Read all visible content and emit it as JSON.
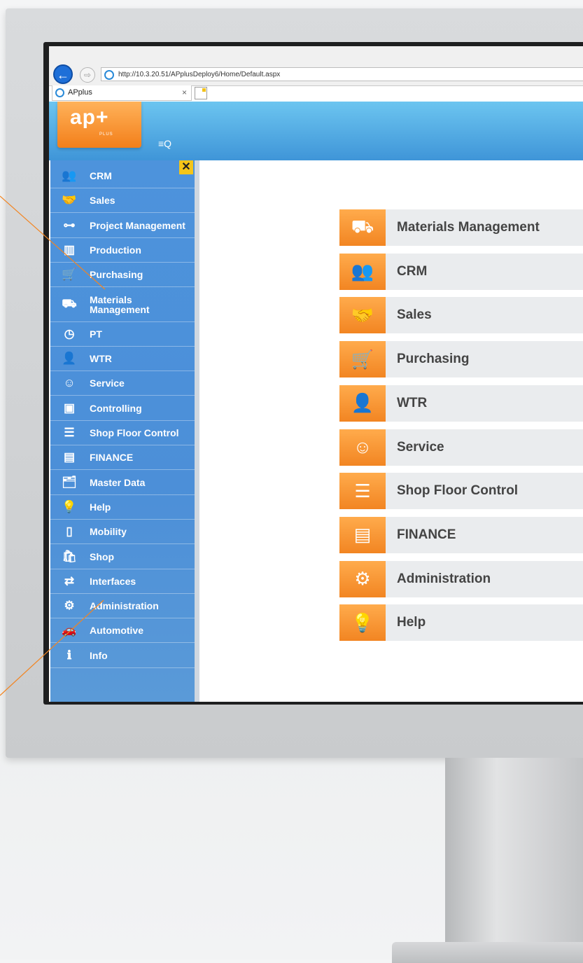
{
  "browser": {
    "url": "http://10.3.20.51/APplusDeploy6/Home/Default.aspx",
    "tab_title": "APplus",
    "tab_close": "×",
    "back_glyph": "←",
    "forward_glyph": "⇨"
  },
  "app": {
    "logo_text": "ap+",
    "logo_subtext": "PLUS",
    "search_toggle_glyph": "≡Q",
    "close_glyph": "✕"
  },
  "sidebar": {
    "items": [
      {
        "label": "CRM",
        "icon": "people-icon",
        "glyph": "👥"
      },
      {
        "label": "Sales",
        "icon": "handshake-icon",
        "glyph": "🤝"
      },
      {
        "label": "Project Management",
        "icon": "org-chart-icon",
        "glyph": "⊶"
      },
      {
        "label": "Production",
        "icon": "factory-icon",
        "glyph": "▥"
      },
      {
        "label": "Purchasing",
        "icon": "cart-icon",
        "glyph": "🛒"
      },
      {
        "label": "Materials Management",
        "icon": "forklift-icon",
        "glyph": "⛟"
      },
      {
        "label": "PT",
        "icon": "time-tracking-icon",
        "glyph": "◷"
      },
      {
        "label": "WTR",
        "icon": "person-clock-icon",
        "glyph": "👤"
      },
      {
        "label": "Service",
        "icon": "service-agent-icon",
        "glyph": "☺"
      },
      {
        "label": "Controlling",
        "icon": "presentation-icon",
        "glyph": "▣"
      },
      {
        "label": "Shop Floor Control",
        "icon": "list-panel-icon",
        "glyph": "☰"
      },
      {
        "label": "FINANCE",
        "icon": "wallet-icon",
        "glyph": "▤"
      },
      {
        "label": "Master Data",
        "icon": "folder-info-icon",
        "glyph": "🗂"
      },
      {
        "label": "Help",
        "icon": "lightbulb-icon",
        "glyph": "💡"
      },
      {
        "label": "Mobility",
        "icon": "phone-icon",
        "glyph": "▯"
      },
      {
        "label": "Shop",
        "icon": "shop-cart-icon",
        "glyph": "🛍"
      },
      {
        "label": "Interfaces",
        "icon": "interfaces-icon",
        "glyph": "⇄"
      },
      {
        "label": "Administration",
        "icon": "sliders-icon",
        "glyph": "⚙"
      },
      {
        "label": "Automotive",
        "icon": "car-icon",
        "glyph": "🚗"
      },
      {
        "label": "Info",
        "icon": "info-icon",
        "glyph": "ℹ"
      }
    ]
  },
  "tiles": [
    {
      "label": "Materials Management",
      "icon": "forklift-icon",
      "glyph": "⛟"
    },
    {
      "label": "CRM",
      "icon": "people-icon",
      "glyph": "👥"
    },
    {
      "label": "Sales",
      "icon": "handshake-icon",
      "glyph": "🤝"
    },
    {
      "label": "Purchasing",
      "icon": "cart-icon",
      "glyph": "🛒"
    },
    {
      "label": "WTR",
      "icon": "person-clock-icon",
      "glyph": "👤"
    },
    {
      "label": "Service",
      "icon": "service-agent-icon",
      "glyph": "☺"
    },
    {
      "label": "Shop Floor Control",
      "icon": "list-panel-icon",
      "glyph": "☰"
    },
    {
      "label": "FINANCE",
      "icon": "wallet-icon",
      "glyph": "▤"
    },
    {
      "label": "Administration",
      "icon": "sliders-icon",
      "glyph": "⚙"
    },
    {
      "label": "Help",
      "icon": "lightbulb-icon",
      "glyph": "💡"
    }
  ],
  "colors": {
    "accent_orange": "#f28522",
    "sidebar_blue": "#4d93dc",
    "header_blue": "#3f95d8",
    "callout_line": "#f28522"
  }
}
